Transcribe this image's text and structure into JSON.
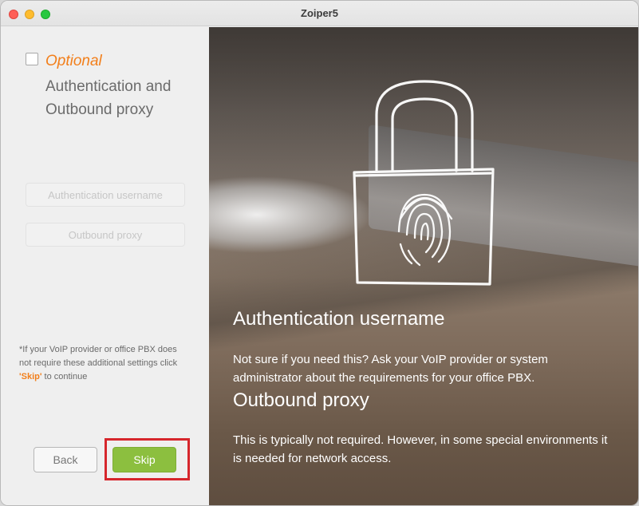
{
  "window": {
    "title": "Zoiper5"
  },
  "wizard": {
    "optional_label": "Optional",
    "step_title": "Authentication and Outbound proxy",
    "auth_username_placeholder": "Authentication username",
    "outbound_proxy_placeholder": "Outbound proxy",
    "note_prefix": "*If your VoIP provider or office PBX does not require these additional settings click ",
    "note_skip": "'Skip'",
    "note_suffix": " to continue",
    "back_label": "Back",
    "skip_label": "Skip"
  },
  "info": {
    "auth_heading": "Authentication username",
    "auth_text": " Not sure if you need this? Ask your VoIP provider or system administrator about the requirements for your office PBX.",
    "proxy_heading": "Outbound proxy",
    "proxy_text": " This is typically not required. However, in some special environments it is needed for network access."
  },
  "colors": {
    "accent_orange": "#f27f1b",
    "skip_green": "#8cbf3f",
    "highlight_red": "#d6262c"
  },
  "icons": [
    "fingerprint-lock-icon"
  ]
}
